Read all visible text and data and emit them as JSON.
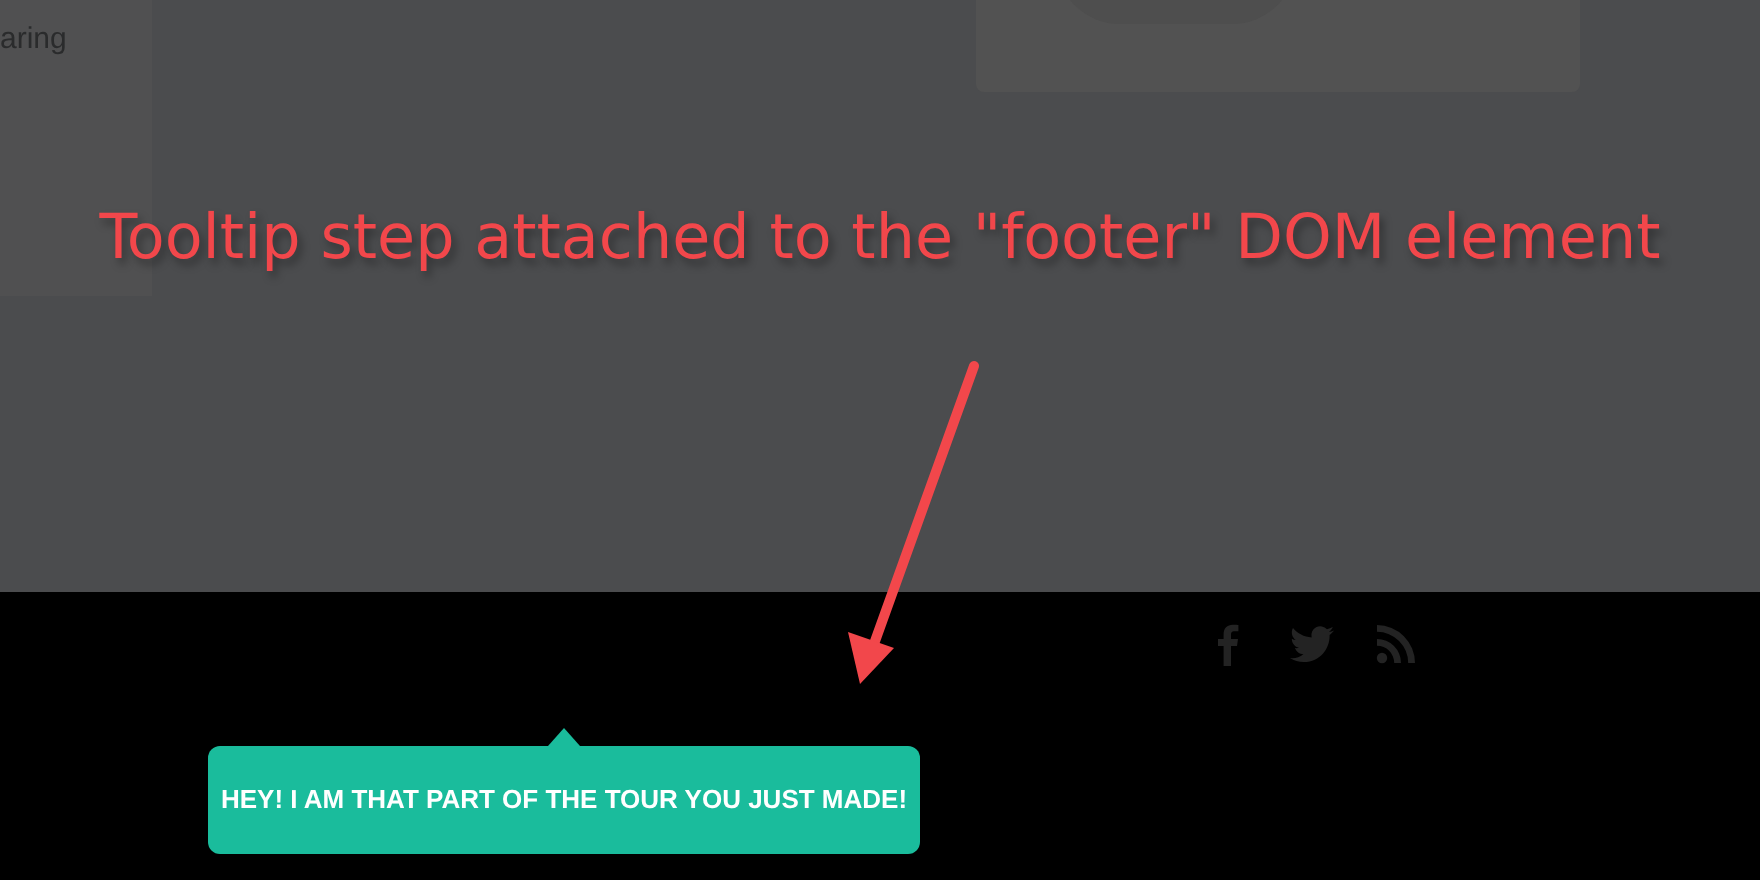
{
  "background_card": {
    "text": "aring"
  },
  "annotation": {
    "text": "Tooltip step attached to the \"footer\" DOM element"
  },
  "footer": {
    "social_icons": [
      {
        "kind": "facebook"
      },
      {
        "kind": "twitter"
      },
      {
        "kind": "rss"
      }
    ]
  },
  "tooltip": {
    "text": "HEY! I AM THAT PART OF THE TOUR YOU JUST MADE!"
  }
}
